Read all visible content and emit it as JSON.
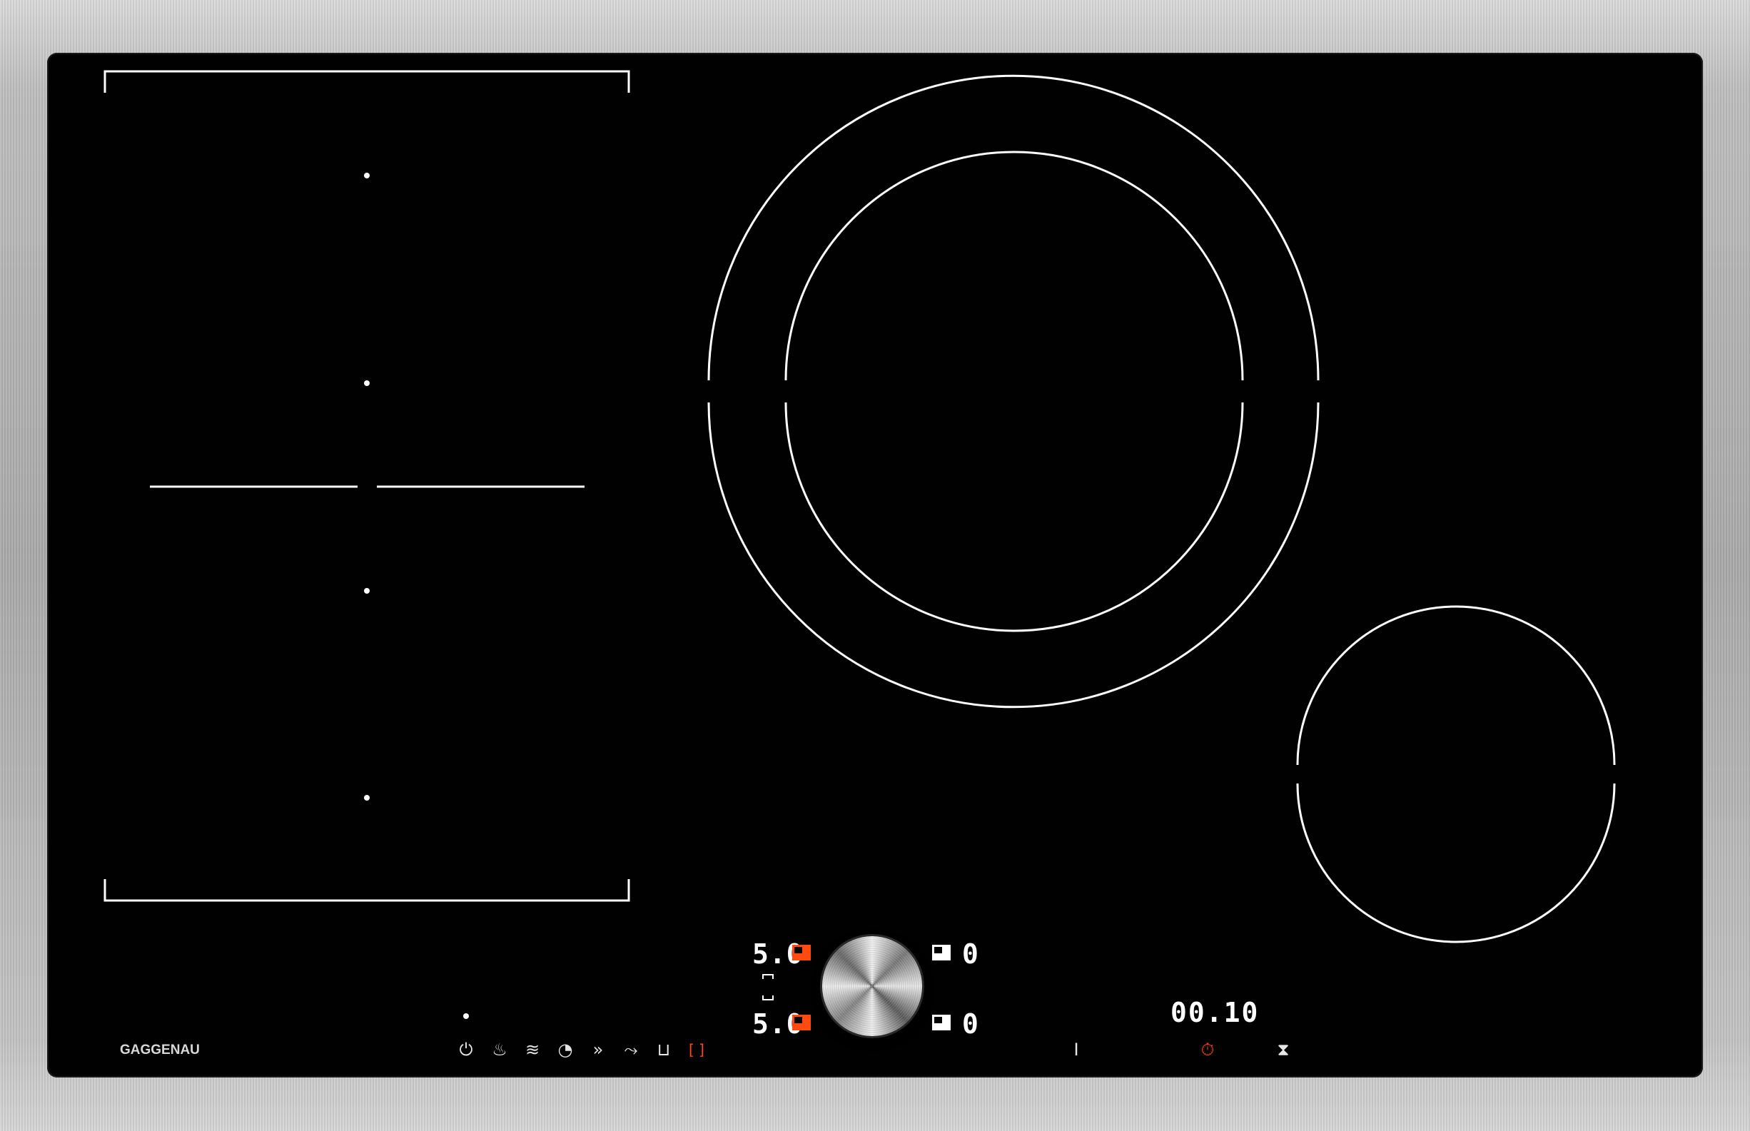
{
  "appliance": {
    "brand": "GAGGENAU"
  },
  "display": {
    "level_top": "5.0",
    "level_bottom": "5.0",
    "value_top_right": "0",
    "value_bottom_right": "0",
    "timer": "00.10"
  },
  "sensors": [
    {
      "name": "power-icon",
      "glyph": "⏻"
    },
    {
      "name": "pot-icon",
      "glyph": "♨"
    },
    {
      "name": "pan-icon",
      "glyph": "≋"
    },
    {
      "name": "frying-timer-icon",
      "glyph": "◔"
    },
    {
      "name": "boost-icon",
      "glyph": "»"
    },
    {
      "name": "keep-warm-icon",
      "glyph": "⤳"
    },
    {
      "name": "extractor-icon",
      "glyph": "⊔"
    },
    {
      "name": "flex-zone-icon",
      "glyph": "[ ]"
    }
  ],
  "right_sensors": [
    {
      "name": "wipe-protect-icon",
      "glyph": "Ι"
    },
    {
      "name": "stopwatch-icon",
      "glyph": "⏱"
    },
    {
      "name": "hourglass-icon",
      "glyph": "⧗"
    }
  ],
  "colors": {
    "glass": "#020102",
    "active": "#ff4a12",
    "markings": "#ffffff"
  }
}
